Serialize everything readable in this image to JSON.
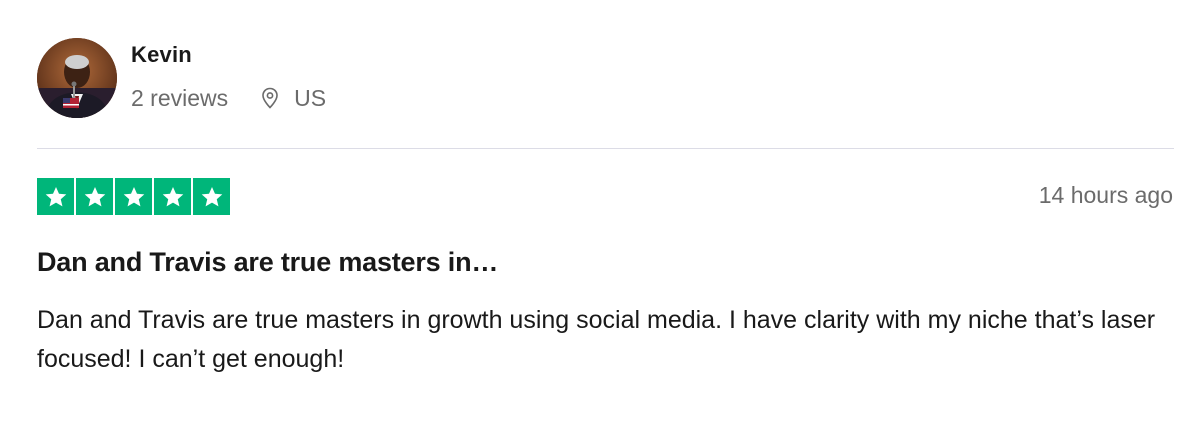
{
  "reviewer": {
    "name": "Kevin",
    "review_count": "2 reviews",
    "country": "US",
    "avatar_icon": "person-avatar"
  },
  "review": {
    "rating": 5,
    "rating_max": 5,
    "star_color": "#00b67a",
    "time_ago": "14 hours ago",
    "title": "Dan and Travis are true masters in…",
    "body": "Dan and Travis are true masters in growth using social media. I have clarity with my niche that’s laser focused! I can’t get enough!"
  },
  "icons": {
    "location": "location-pin-icon",
    "star": "star-icon"
  }
}
